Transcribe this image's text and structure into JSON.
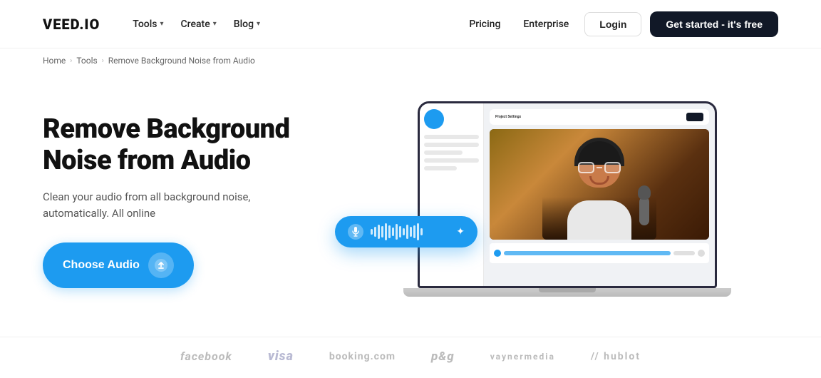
{
  "brand": {
    "logo": "VEED.IO"
  },
  "nav": {
    "items": [
      {
        "label": "Tools",
        "hasDropdown": true
      },
      {
        "label": "Create",
        "hasDropdown": true
      },
      {
        "label": "Blog",
        "hasDropdown": true
      }
    ],
    "right": [
      {
        "label": "Pricing"
      },
      {
        "label": "Enterprise"
      }
    ],
    "login_label": "Login",
    "cta_label": "Get started - it's free"
  },
  "breadcrumb": {
    "items": [
      {
        "label": "Home"
      },
      {
        "label": "Tools"
      },
      {
        "label": "Remove Background Noise from Audio"
      }
    ]
  },
  "hero": {
    "title": "Remove Background\nNoise from Audio",
    "subtitle": "Clean your audio from all background noise, automatically. All online",
    "cta_label": "Choose Audio"
  },
  "trust_logos": [
    {
      "label": "facebook",
      "class": "facebook"
    },
    {
      "label": "VISA",
      "class": "visa"
    },
    {
      "label": "Booking.com",
      "class": "booking"
    },
    {
      "label": "P&G",
      "class": "pg"
    },
    {
      "label": "VAYNERMEDIA",
      "class": "vaynermedia"
    },
    {
      "label": "// HUBLOT",
      "class": "hublot"
    }
  ],
  "waveform": {
    "heights": [
      8,
      14,
      20,
      16,
      24,
      18,
      12,
      22,
      16,
      10,
      20,
      14,
      18,
      24,
      10
    ]
  }
}
